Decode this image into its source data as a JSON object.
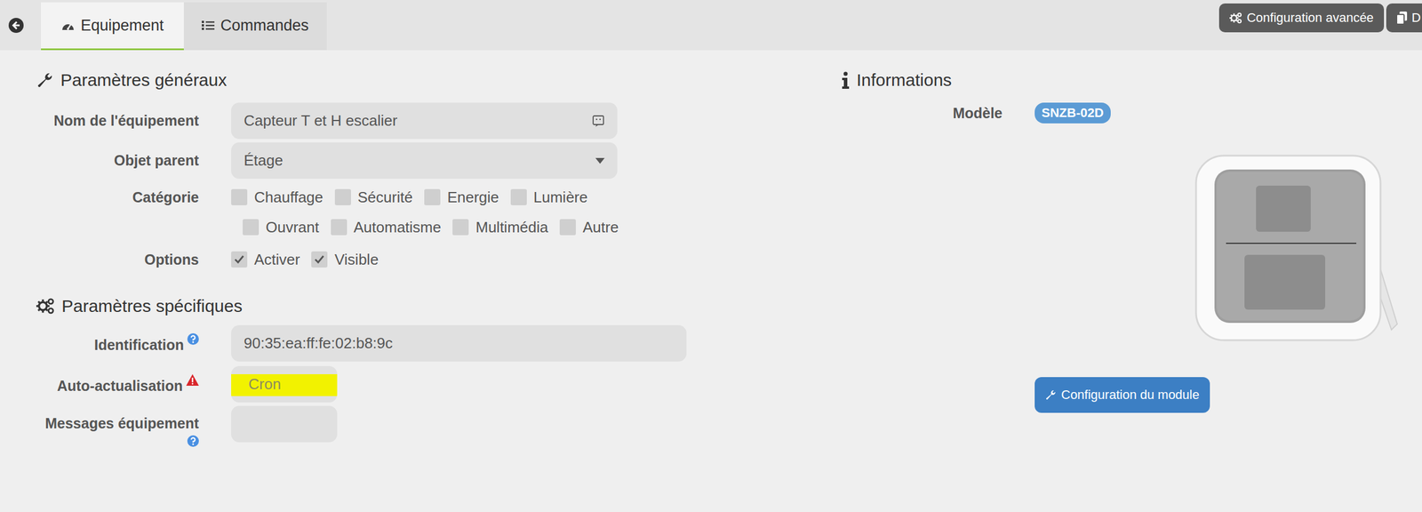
{
  "toolbar": {
    "tabs": [
      {
        "label": "Equipement",
        "selected": true
      },
      {
        "label": "Commandes",
        "selected": false
      }
    ],
    "buttons": [
      {
        "label": "Configuration avancée"
      },
      {
        "label": "D"
      }
    ]
  },
  "general": {
    "title": "Paramètres généraux",
    "name": {
      "label": "Nom de l'équipement",
      "value": "Capteur T et H escalier"
    },
    "parent": {
      "label": "Objet parent",
      "value": "Étage"
    },
    "category": {
      "label": "Catégorie",
      "items": [
        {
          "label": "Chauffage",
          "checked": false
        },
        {
          "label": "Sécurité",
          "checked": false
        },
        {
          "label": "Energie",
          "checked": false
        },
        {
          "label": "Lumière",
          "checked": false
        },
        {
          "label": "Ouvrant",
          "checked": false
        },
        {
          "label": "Automatisme",
          "checked": false
        },
        {
          "label": "Multimédia",
          "checked": false
        },
        {
          "label": "Autre",
          "checked": false
        }
      ]
    },
    "options": {
      "label": "Options",
      "items": [
        {
          "label": "Activer",
          "checked": true
        },
        {
          "label": "Visible",
          "checked": true
        }
      ]
    }
  },
  "specific": {
    "title": "Paramètres spécifiques",
    "identification": {
      "label": "Identification",
      "value": "90:35:ea:ff:fe:02:b8:9c"
    },
    "auto_refresh": {
      "label": "Auto-actualisation",
      "placeholder": "Cron",
      "highlighted": true
    },
    "messages": {
      "label": "Messages équipement",
      "value": ""
    }
  },
  "info": {
    "title": "Informations",
    "model_label": "Modèle",
    "model": "SNZB-02D",
    "button": "Configuration du module"
  }
}
